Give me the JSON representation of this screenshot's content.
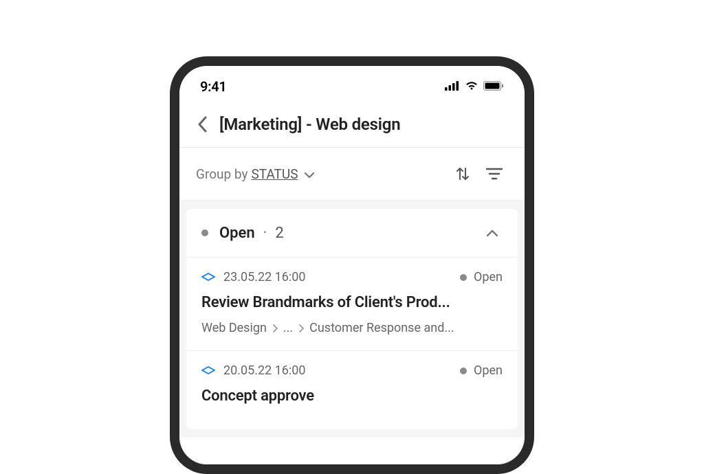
{
  "status_bar": {
    "time": "9:41"
  },
  "header": {
    "title": "[Marketing] - Web design"
  },
  "toolbar": {
    "group_by_label": "Group by",
    "group_by_value": "STATUS"
  },
  "group": {
    "name": "Open",
    "separator": "·",
    "count": "2"
  },
  "tasks": [
    {
      "datetime": "23.05.22 16:00",
      "status": "Open",
      "title": "Review Brandmarks of Client's Prod...",
      "breadcrumb": [
        "Web Design",
        "...",
        "Customer Response and..."
      ]
    },
    {
      "datetime": "20.05.22 16:00",
      "status": "Open",
      "title": "Concept approve"
    }
  ]
}
